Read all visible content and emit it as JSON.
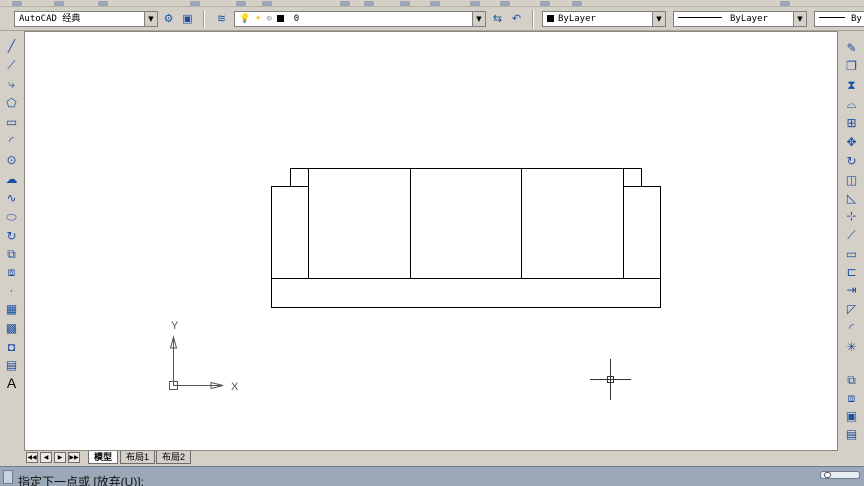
{
  "toolbar": {
    "workspace_value": "AutoCAD 经典",
    "layer_value": "0",
    "color_value": "ByLayer",
    "linetype_value": "ByLayer",
    "lineweight_value": "By"
  },
  "layout_tabs": [
    {
      "label": "模型",
      "active": true
    },
    {
      "label": "布局1",
      "active": false
    },
    {
      "label": "布局2",
      "active": false
    }
  ],
  "ucs": {
    "x_label": "X",
    "y_label": "Y"
  },
  "command_line": {
    "text": "指定下一点或 [放弃(U)]:"
  },
  "colors": {
    "canvas_bg": "#ffffff",
    "ui_bg": "#d4d0c8",
    "command_bg": "#9aa8b8",
    "icon_blue": "#1d4fa3"
  }
}
